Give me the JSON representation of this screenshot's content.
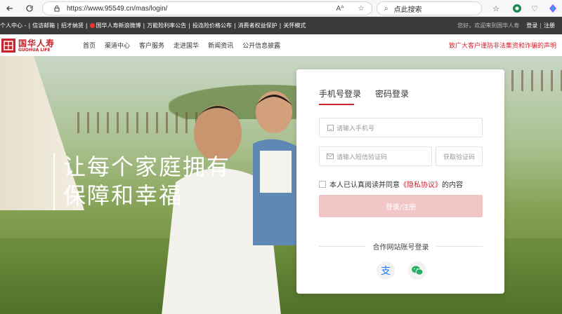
{
  "browser": {
    "url": "https://www.95549.cn/mas/login/",
    "search_placeholder": "点此搜索"
  },
  "topbar": {
    "links": [
      "个人中心 -",
      "信访邮箱",
      "招才纳贤",
      "国华人寿新浪微博",
      "万能险利率公告",
      "投连险价格公布",
      "消费者权益保护",
      "关怀模式"
    ],
    "welcome": "您好，欢迎来到国华人寿",
    "login": "登录",
    "register": "注册"
  },
  "header": {
    "logo_cn": "国华人寿",
    "logo_en": "GUOHUA LIFE",
    "menu": [
      "首页",
      "渠道中心",
      "客户服务",
      "走进国华",
      "新闻资讯",
      "公开信息披露"
    ],
    "notice": "致广大客户谨防非法集资和诈骗的声明"
  },
  "hero": {
    "slogan_line1": "让每个家庭拥有",
    "slogan_line2": "保障和幸福"
  },
  "login": {
    "tab_phone": "手机号登录",
    "tab_password": "密码登录",
    "phone_placeholder": "请输入手机号",
    "sms_placeholder": "请输入短信验证码",
    "get_code": "获取验证码",
    "agree_prefix": "本人已认真阅读并同意",
    "agree_link": "《隐私协议》",
    "agree_suffix": "的内容",
    "submit": "登录/注册",
    "partner_title": "合作网站账号登录"
  },
  "colors": {
    "brand_red": "#c9232c",
    "submit_disabled": "#f2c5c7",
    "topbar_bg": "#3b3b3b"
  }
}
